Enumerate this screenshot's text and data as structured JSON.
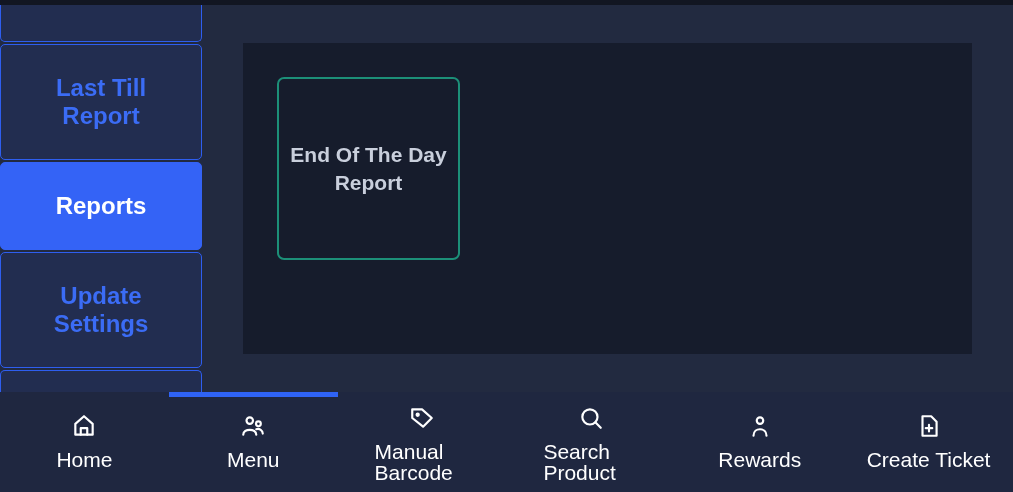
{
  "sidebar": {
    "items": [
      {
        "selected": false
      },
      {
        "label": "Last Till Report",
        "selected": false
      },
      {
        "label": "Reports",
        "selected": true
      },
      {
        "label": "Update Settings",
        "selected": false
      },
      {
        "selected": false
      }
    ]
  },
  "tiles": [
    {
      "label": "End Of The Day Report"
    }
  ],
  "nav": [
    {
      "label": "Home",
      "kind": "home",
      "selected": false
    },
    {
      "label": "Menu",
      "kind": "people",
      "selected": true
    },
    {
      "label": "Manual Barcode",
      "kind": "tag",
      "selected": false
    },
    {
      "label": "Search Product",
      "kind": "search",
      "selected": false
    },
    {
      "label": "Rewards",
      "kind": "person",
      "selected": false
    },
    {
      "label": "Create Ticket",
      "kind": "file-plus",
      "selected": false
    }
  ]
}
